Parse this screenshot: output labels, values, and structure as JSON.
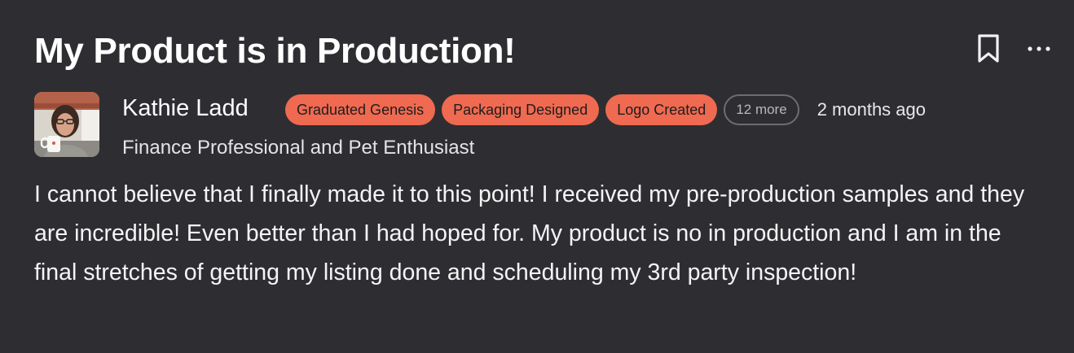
{
  "post": {
    "title": "My Product is in Production!",
    "author": {
      "name": "Kathie Ladd",
      "bio": "Finance Professional and Pet Enthusiast",
      "avatar_icon": "user-photo"
    },
    "badges": [
      {
        "label": "Graduated Genesis"
      },
      {
        "label": "Packaging Designed"
      },
      {
        "label": "Logo Created"
      }
    ],
    "more_badges_label": "12 more",
    "timestamp": "2 months ago",
    "body": "I cannot believe that I finally made it to this point! I received my pre-production samples and they are incredible! Even better than I had hoped for. My product is no in production and I am in the final stretches of getting my listing done and scheduling my 3rd party inspection!",
    "actions": {
      "bookmark_icon": "bookmark-icon",
      "more_icon": "more-horizontal-icon"
    }
  },
  "colors": {
    "background": "#2e2e32",
    "badge": "#ef6a50",
    "badge_text": "#1d1d1f",
    "more_badge_border": "#6c6c72"
  }
}
